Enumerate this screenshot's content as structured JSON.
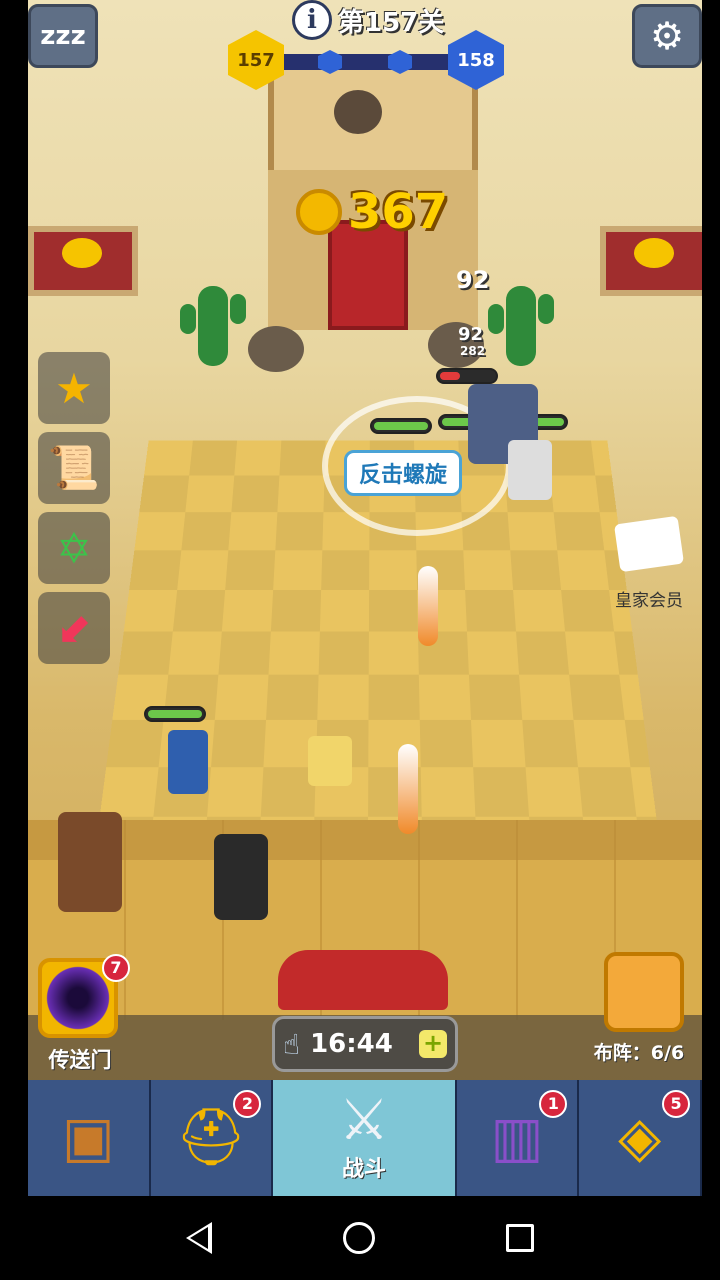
{
  "hud": {
    "level_title": "第157关",
    "current_level": "157",
    "next_level": "158",
    "gold": "367",
    "info_icon": "info-icon",
    "sleep_icon": "zzz",
    "settings_icon": "⚙"
  },
  "battle": {
    "damage_1": "92",
    "damage_2": "92",
    "damage_3": "282",
    "skill_name": "反击螺旋"
  },
  "side_menu": {
    "items": [
      "trophy-icon",
      "scroll-icon",
      "hexagram-icon",
      "arrow-icon"
    ]
  },
  "vip": {
    "label": "皇家会员"
  },
  "portal": {
    "label": "传送门",
    "badge": "7"
  },
  "formation": {
    "label": "布阵：6/6"
  },
  "timer": {
    "time": "16:44",
    "plus": "+"
  },
  "nav": {
    "tabs": [
      {
        "icon": "chest-icon",
        "badge": ""
      },
      {
        "icon": "viking-helmet-icon",
        "badge": "2"
      },
      {
        "icon": "crossed-swords-icon",
        "label": "战斗",
        "badge": ""
      },
      {
        "icon": "spellbook-icon",
        "badge": "1"
      },
      {
        "icon": "amulet-icon",
        "badge": "5"
      }
    ]
  },
  "colors": {
    "sand": "#e9c460",
    "gold_text": "#ffd000",
    "nav_bg": "#3a5585",
    "nav_active": "#7fc6d6",
    "badge": "#d7263d"
  }
}
